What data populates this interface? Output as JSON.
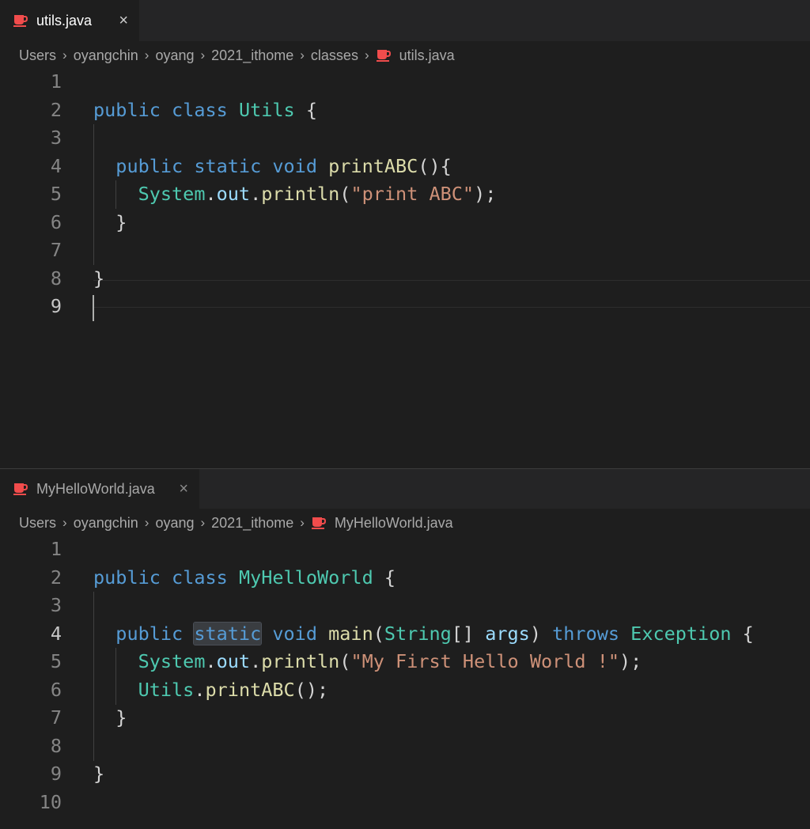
{
  "colors": {
    "java_icon": "#f14c4c",
    "keyword": "#569cd6",
    "type": "#4ec9b0",
    "function": "#dcdcaa",
    "string": "#ce9178",
    "variable": "#9cdcfe"
  },
  "top_editor": {
    "tab": {
      "label": "utils.java",
      "close_icon": "×",
      "icon": "java-coffee-icon"
    },
    "breadcrumb": [
      "Users",
      "oyangchin",
      "oyang",
      "2021_ithome",
      "classes",
      "utils.java"
    ],
    "breadcrumb_separator": "›",
    "line_numbers": [
      "1",
      "2",
      "3",
      "4",
      "5",
      "6",
      "7",
      "8",
      "9"
    ],
    "active_line": "9",
    "code": {
      "l2_kw1": "public",
      "l2_kw2": "class",
      "l2_type": "Utils",
      "l2_rest": " {",
      "l4_kw1": "public",
      "l4_kw2": "static",
      "l4_kw3": "void",
      "l4_fn": "printABC",
      "l4_rest": "(){",
      "l5_type": "System",
      "l5_dot1": ".",
      "l5_var": "out",
      "l5_dot2": ".",
      "l5_fn": "println",
      "l5_open": "(",
      "l5_str": "\"print ABC\"",
      "l5_close": ");",
      "l6": "}",
      "l8": "}"
    }
  },
  "bottom_editor": {
    "tab": {
      "label": "MyHelloWorld.java",
      "close_icon": "×",
      "icon": "java-coffee-icon"
    },
    "breadcrumb": [
      "Users",
      "oyangchin",
      "oyang",
      "2021_ithome",
      "MyHelloWorld.java"
    ],
    "breadcrumb_separator": "›",
    "line_numbers": [
      "1",
      "2",
      "3",
      "4",
      "5",
      "6",
      "7",
      "8",
      "9",
      "10"
    ],
    "active_line": "4",
    "code": {
      "l2_kw1": "public",
      "l2_kw2": "class",
      "l2_type": "MyHelloWorld",
      "l2_rest": " {",
      "l4_kw1": "public",
      "l4_kw2": "static",
      "l4_kw3": "void",
      "l4_fn": "main",
      "l4_open": "(",
      "l4_type1": "String",
      "l4_br": "[] ",
      "l4_var": "args",
      "l4_close": ") ",
      "l4_kw4": "throws",
      "l4_type2": "Exception",
      "l4_rest": " {",
      "l5_type": "System",
      "l5_dot1": ".",
      "l5_var": "out",
      "l5_dot2": ".",
      "l5_fn": "println",
      "l5_open": "(",
      "l5_str": "\"My First Hello World !\"",
      "l5_close": ");",
      "l6_type": "Utils",
      "l6_dot": ".",
      "l6_fn": "printABC",
      "l6_rest": "();",
      "l7": "}",
      "l9": "}"
    }
  }
}
